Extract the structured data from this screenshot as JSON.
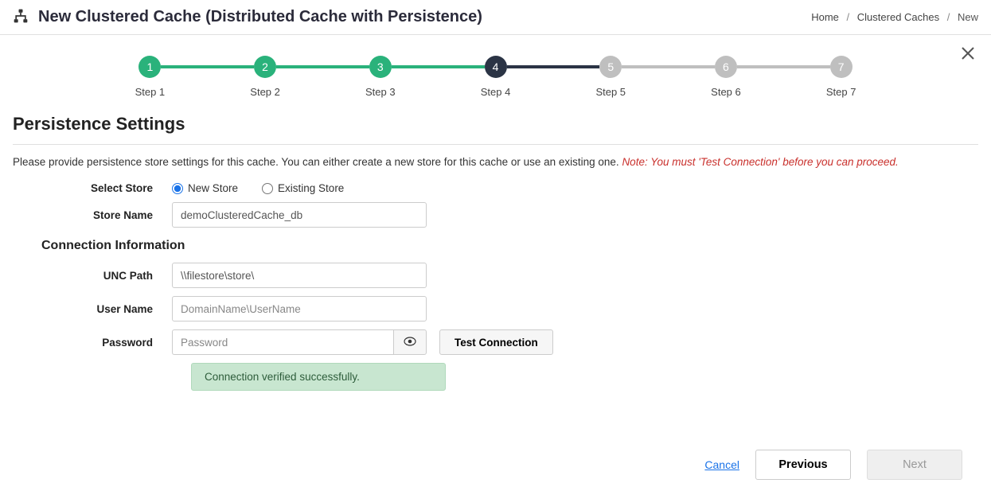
{
  "header": {
    "title": "New Clustered Cache (Distributed Cache with Persistence)"
  },
  "breadcrumb": {
    "home": "Home",
    "caches": "Clustered Caches",
    "current": "New"
  },
  "wizard": {
    "steps": [
      {
        "num": "1",
        "label": "Step 1",
        "state": "done"
      },
      {
        "num": "2",
        "label": "Step 2",
        "state": "done"
      },
      {
        "num": "3",
        "label": "Step 3",
        "state": "done"
      },
      {
        "num": "4",
        "label": "Step 4",
        "state": "current"
      },
      {
        "num": "5",
        "label": "Step 5",
        "state": "future"
      },
      {
        "num": "6",
        "label": "Step 6",
        "state": "future"
      },
      {
        "num": "7",
        "label": "Step 7",
        "state": "future"
      }
    ]
  },
  "page": {
    "section_title": "Persistence Settings",
    "helper_text": "Please provide persistence store settings for this cache. You can either create a new store for this cache or use an existing one. ",
    "helper_note": "Note: You must 'Test Connection' before you can proceed."
  },
  "form": {
    "select_store_label": "Select Store",
    "new_store_label": "New Store",
    "existing_store_label": "Existing Store",
    "select_store_value": "new",
    "store_name_label": "Store Name",
    "store_name_value": "demoClusteredCache_db",
    "connection_section": "Connection Information",
    "unc_path_label": "UNC Path",
    "unc_path_value": "\\\\filestore\\store\\",
    "user_name_label": "User Name",
    "user_name_placeholder": "DomainName\\UserName",
    "user_name_value": "",
    "password_label": "Password",
    "password_placeholder": "Password",
    "password_value": "",
    "test_connection_label": "Test Connection",
    "success_message": "Connection verified successfully."
  },
  "footer": {
    "cancel": "Cancel",
    "previous": "Previous",
    "next": "Next"
  },
  "colors": {
    "step_done": "#2ab27b",
    "step_current": "#2b3445",
    "step_future": "#bfbfbf"
  }
}
